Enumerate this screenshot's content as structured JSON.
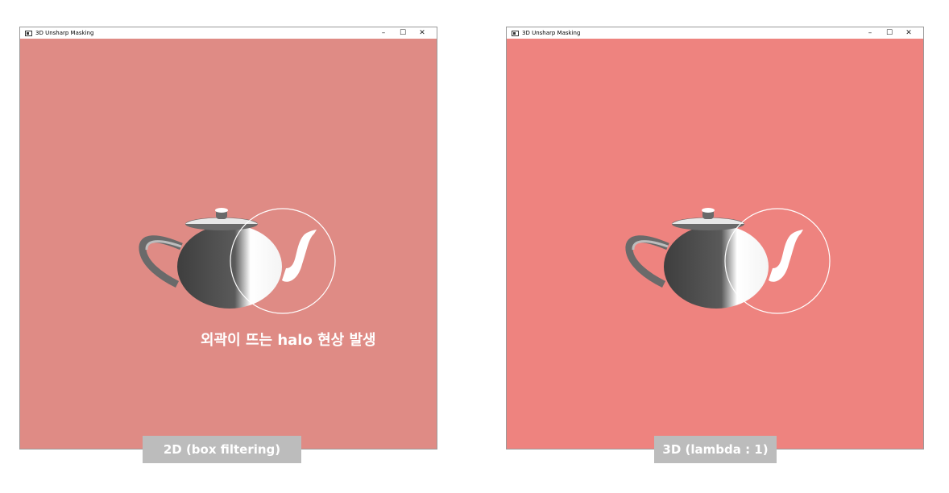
{
  "left_window": {
    "title": "3D Unsharp Masking",
    "minimize": "–",
    "maximize": "☐",
    "close": "✕",
    "background": "#df8b85",
    "annotation": "외곽이 뜨는 halo 현상 발생",
    "caption": "2D (box filtering)"
  },
  "right_window": {
    "title": "3D Unsharp Masking",
    "minimize": "–",
    "maximize": "☐",
    "close": "✕",
    "background": "#ee837f",
    "caption": "3D (lambda : 1)"
  },
  "colors": {
    "caption_bg": "#bcbcbc",
    "teapot_dark": "#555555",
    "teapot_light": "#ffffff",
    "highlight_circle": "#ffffff"
  },
  "icons": [
    "app-icon",
    "minimize-icon",
    "maximize-icon",
    "close-icon",
    "teapot-icon"
  ]
}
